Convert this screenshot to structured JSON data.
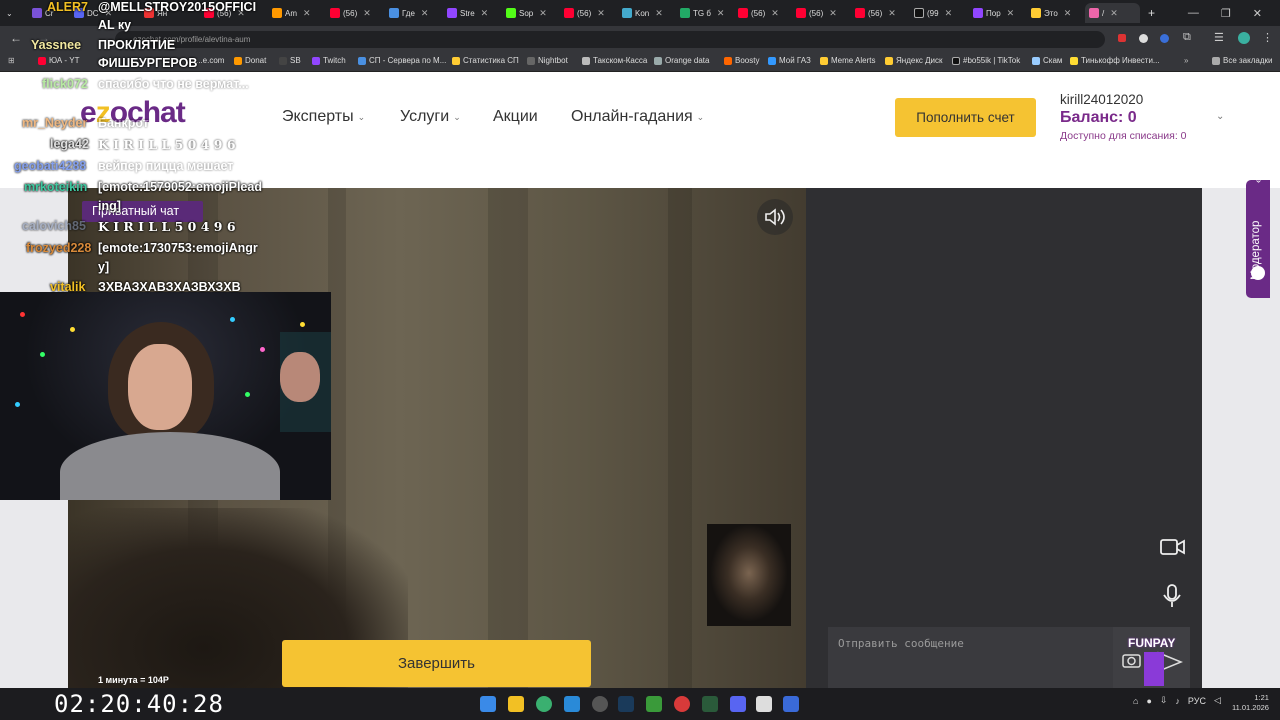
{
  "browser": {
    "tabs": [
      "Cr",
      "DC",
      "Ян",
      "(56)",
      "Am",
      "(56)",
      "Где",
      "Stre",
      "Sop",
      "(56)",
      "Kon",
      "TG б",
      "(56)",
      "(56)",
      "(56)",
      "(99",
      "Пор",
      "Это",
      "/"
    ],
    "new_tab": "+",
    "url": "ezochat.com/profile/alevtina-aum",
    "bookmarks": [
      "ЮА - YT",
      "Donat",
      "SB",
      "Twitch",
      "СП - Сервера по М...",
      "Статистика СП",
      "Nightbot",
      "Такском-Касса",
      "Orange data",
      "Boosty",
      "Мой ГАЗ",
      "Meme Alerts",
      "Яндекс Диск",
      "#bo55ik | TikTok",
      "Скам",
      "Тинькофф Инвести..."
    ],
    "all_bookmarks": "Все закладки",
    "truncated_bookmark": "...e.com"
  },
  "site": {
    "logo": {
      "pre": "e",
      "z": "z",
      "post": "ochat"
    },
    "nav": [
      "Эксперты",
      "Услуги",
      "Акции",
      "Онлайн-гадания"
    ],
    "topup_label": "Пополнить счет",
    "username": "kirill24012020",
    "balance": "Баланс: 0",
    "available": "Доступно для списания: 0"
  },
  "call": {
    "private_chat": "Приватный чат",
    "message_placeholder": "Отправить сообщение",
    "end_label": "Завершить",
    "rate": "1 минута = 104Р",
    "moderator": "Модератор"
  },
  "stream": {
    "timer": "02:20:40:28",
    "chat": [
      {
        "user": "ALER7",
        "color": "#f2c024",
        "msg": "@MELLSTROY2015OFFICI"
      },
      {
        "user": "",
        "color": "#fff",
        "msg": "AL ку"
      },
      {
        "user": "Yassnee",
        "color": "#f2e8a0",
        "msg": "ПРОКЛЯТИЕ"
      },
      {
        "user": "",
        "color": "#fff",
        "msg": "ФИШБУРГЕРОВ"
      },
      {
        "user": "flick072",
        "color": "#7ed957",
        "msg": "спасибо что не вермат..."
      },
      {
        "user": "mr_Neyder",
        "color": "#e89a4c",
        "msg": "Банкрот"
      },
      {
        "user": "lega42",
        "color": "#e0e0e0",
        "msg": "K I R I L L  5 0 4 9 6"
      },
      {
        "user": "geobati4288",
        "color": "#5a7fe8",
        "msg": "вейпер пицца мешает"
      },
      {
        "user": "mrkoteikin",
        "color": "#3ec8a0",
        "msg": "[emote:1579052:emojiPlead"
      },
      {
        "user": "",
        "color": "#fff",
        "msg": "ing]"
      },
      {
        "user": "calovich85",
        "color": "#7a8aa8",
        "msg": "K I R I L L  5 0 4 9 6"
      },
      {
        "user": "frozyed228",
        "color": "#d88a3a",
        "msg": "[emote:1730753:emojiAngr"
      },
      {
        "user": "",
        "color": "#fff",
        "msg": "y]"
      },
      {
        "user": "vitalik",
        "color": "#f2c024",
        "msg": "ЗХВАЗХАВЗХАЗВХЗХВ"
      }
    ],
    "funpay": "FUNPAY"
  },
  "taskbar": {
    "lang": "РУС",
    "time": "1:21",
    "date": "11.01.2026"
  },
  "colors": {
    "brand_purple": "#6a2a86",
    "accent_yellow": "#f5c332"
  }
}
